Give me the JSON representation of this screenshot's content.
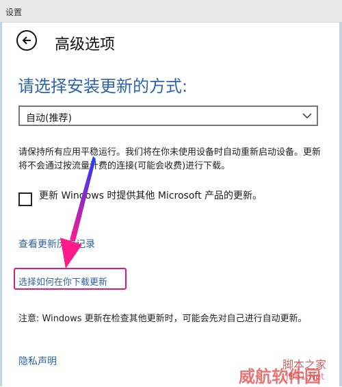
{
  "window": {
    "title": "设置"
  },
  "header": {
    "title": "高级选项"
  },
  "section": {
    "heading": "请选择安装更新的方式:"
  },
  "install_mode": {
    "selected": "自动(推荐)"
  },
  "description": "请保持所有应用平稳运行。我们将在你未使用设备时自动重新启动设备。更新将不会通过按流量计费的连接(可能会收费)进行下载。",
  "checkbox": {
    "label": "更新 Windows 时提供其他 Microsoft 产品的更新。",
    "checked": false
  },
  "links": {
    "history": "查看更新历史记录",
    "download_choice": "选择如何在你下载更新",
    "privacy": "隐私声明"
  },
  "note": "注意: Windows 更新在检查其他更新时，可能会先对自己进行自动更新。",
  "watermark": {
    "line1": "脚本之家",
    "line2": "威航软件园",
    "line3": "JB51.Net"
  },
  "colors": {
    "accent": "#2f64a9",
    "highlight": "#e01a6e",
    "arrow": "#8a2be2"
  },
  "icons": {
    "back": "back-arrow-icon",
    "dropdown": "chevron-down-icon"
  }
}
